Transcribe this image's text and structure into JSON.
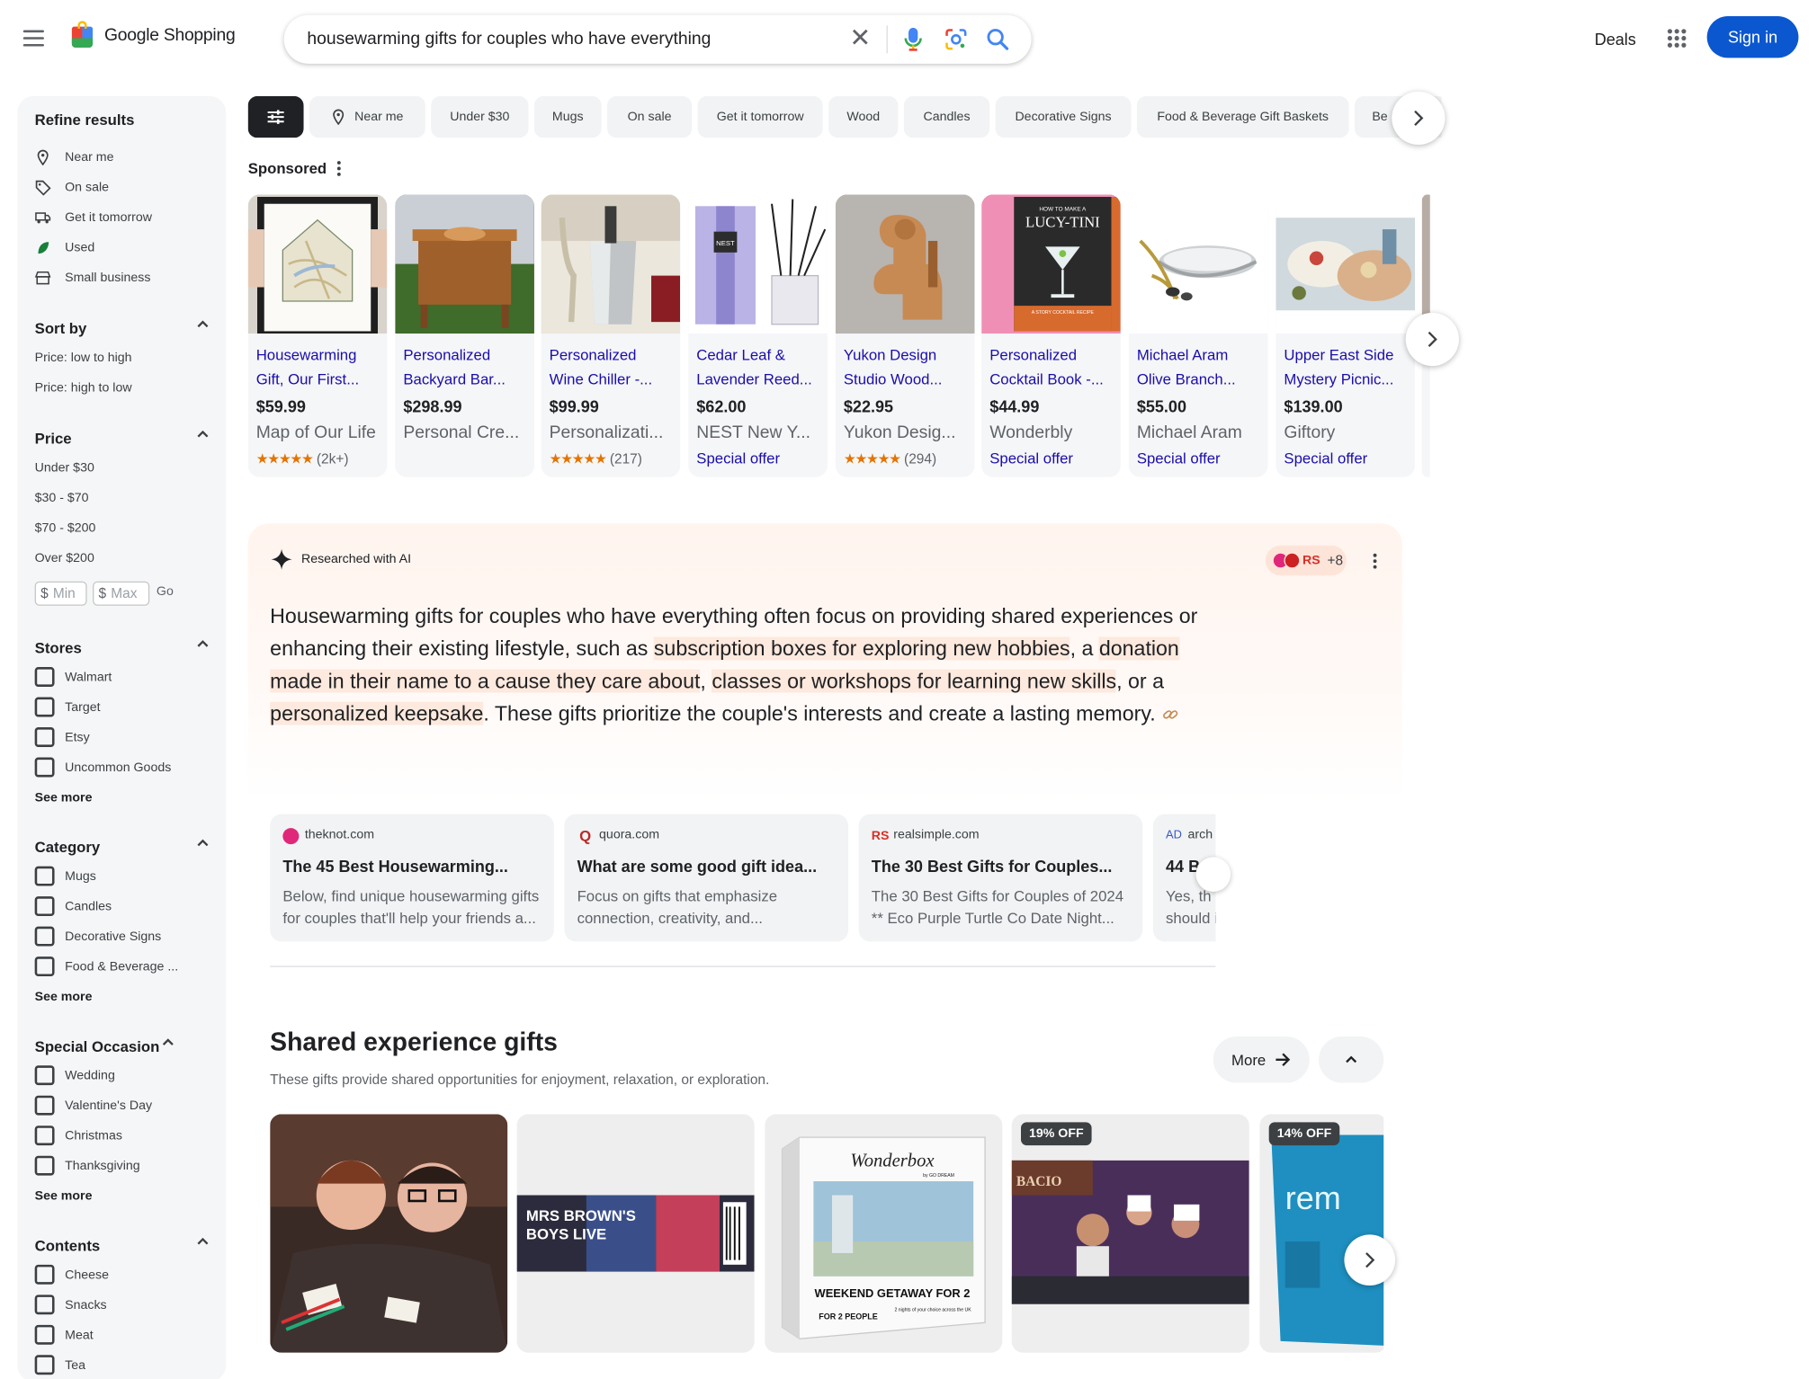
{
  "header": {
    "logo_word": "Google Shopping",
    "search_value": "housewarming gifts for couples who have everything",
    "deals": "Deals",
    "sign_in": "Sign in"
  },
  "sidebar": {
    "title": "Refine results",
    "quick": [
      {
        "label": "Near me",
        "icon": "location-icon"
      },
      {
        "label": "On sale",
        "icon": "tag-icon"
      },
      {
        "label": "Get it tomorrow",
        "icon": "truck-icon"
      },
      {
        "label": "Used",
        "icon": "leaf-icon"
      },
      {
        "label": "Small business",
        "icon": "store-icon"
      }
    ],
    "sort": {
      "title": "Sort by",
      "options": [
        "Price: low to high",
        "Price: high to low"
      ]
    },
    "price": {
      "title": "Price",
      "options": [
        "Under $30",
        "$30 - $70",
        "$70 - $200",
        "Over $200"
      ],
      "currency": "$",
      "min_placeholder": "Min",
      "max_placeholder": "Max",
      "go": "Go"
    },
    "stores": {
      "title": "Stores",
      "options": [
        "Walmart",
        "Target",
        "Etsy",
        "Uncommon Goods"
      ],
      "see_more": "See more"
    },
    "category": {
      "title": "Category",
      "options": [
        "Mugs",
        "Candles",
        "Decorative Signs",
        "Food & Beverage ..."
      ],
      "see_more": "See more"
    },
    "occasion": {
      "title": "Special Occasion",
      "options": [
        "Wedding",
        "Valentine's Day",
        "Christmas",
        "Thanksgiving"
      ],
      "see_more": "See more"
    },
    "contents": {
      "title": "Contents",
      "options": [
        "Cheese",
        "Snacks",
        "Meat",
        "Tea"
      ]
    }
  },
  "chips": [
    "Near me",
    "Under $30",
    "Mugs",
    "On sale",
    "Get it tomorrow",
    "Wood",
    "Candles",
    "Decorative Signs",
    "Food & Beverage Gift Baskets",
    "Be"
  ],
  "sponsored": {
    "label": "Sponsored",
    "products": [
      {
        "name1": "Housewarming",
        "name2": "Gift, Our First...",
        "price": "$59.99",
        "store": "Map of Our Life",
        "stars": "★★★★★",
        "reviews": "(2k+)"
      },
      {
        "name1": "Personalized",
        "name2": "Backyard Bar...",
        "price": "$298.99",
        "store": "Personal Cre..."
      },
      {
        "name1": "Personalized",
        "name2": "Wine Chiller -...",
        "price": "$99.99",
        "store": "Personalizati...",
        "stars": "★★★★★",
        "reviews": "(217)"
      },
      {
        "name1": "Cedar Leaf &",
        "name2": "Lavender Reed...",
        "price": "$62.00",
        "store": "NEST New Y...",
        "offer": "Special offer"
      },
      {
        "name1": "Yukon Design",
        "name2": "Studio Wood...",
        "price": "$22.95",
        "store": "Yukon Desig...",
        "stars": "★★★★★",
        "reviews": "(294)"
      },
      {
        "name1": "Personalized",
        "name2": "Cocktail Book -...",
        "price": "$44.99",
        "store": "Wonderbly",
        "offer": "Special offer"
      },
      {
        "name1": "Michael Aram",
        "name2": "Olive Branch...",
        "price": "$55.00",
        "store": "Michael Aram",
        "offer": "Special offer"
      },
      {
        "name1": "Upper East Side",
        "name2": "Mystery Picnic...",
        "price": "$139.00",
        "store": "Giftory",
        "offer": "Special offer"
      }
    ],
    "image_text": {
      "nest": "NEST",
      "book_small": "HOW TO MAKE A",
      "book_title": "LUCY-TINI",
      "book_bottom": "A STORY COCKTAIL RECIPE"
    }
  },
  "ai": {
    "label": "Researched with AI",
    "avatar_text": "RS",
    "avatar_count": "+8",
    "text": {
      "t1": "Housewarming gifts for couples who have everything often focus on providing shared experiences or enhancing their existing lifestyle, such as ",
      "h1": "subscription boxes for exploring new hobbies",
      "t2": ", a ",
      "h2": "donation made in their name to a cause they care about",
      "t3": ", ",
      "h3": "classes or workshops for learning new skills",
      "t4": ", or a ",
      "h4": "personalized keepsake",
      "t5": ". These gifts prioritize the couple's interests and create a lasting memory."
    },
    "sources": [
      {
        "domain": "theknot.com",
        "title": "The 45 Best Housewarming...",
        "d1": "Below, find unique housewarming gifts",
        "d2": "for couples that'll help your friends a..."
      },
      {
        "domain": "quora.com",
        "title": "What are some good gift idea...",
        "d1": "Focus on gifts that emphasize",
        "d2": "connection, creativity, and..."
      },
      {
        "domain": "realsimple.com",
        "title": "The 30 Best Gifts for Couples...",
        "d1": "The 30 Best Gifts for Couples of 2024",
        "d2": "** Eco Purple Turtle Co Date Night..."
      },
      {
        "domain": "arch",
        "title": "44 B",
        "d1": "Yes, th",
        "d2": "should i"
      }
    ],
    "source_marks": {
      "quora": "Q",
      "realsimple": "RS",
      "arch": "AD"
    }
  },
  "shared": {
    "title": "Shared experience gifts",
    "subtitle": "These gifts provide shared opportunities for enjoyment, relaxation, or exploration.",
    "more": "More",
    "badges": [
      "19% OFF",
      "14% OFF"
    ],
    "image_text": {
      "show_title1": "MRS BROWN'S",
      "show_title2": "BOYS LIVE",
      "box_brand": "Wonderbox",
      "box_sub": "by GO DREAM",
      "box_title": "WEEKEND GETAWAY FOR 2",
      "box_people": "FOR 2 PEOPLE",
      "box_small": "2 nights of your choice across the UK",
      "restaurant": "BACIO",
      "pack_brand": "rem"
    }
  }
}
